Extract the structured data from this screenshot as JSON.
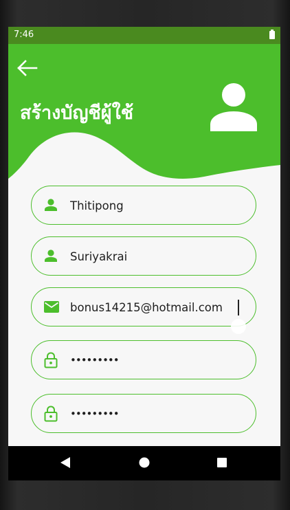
{
  "status_bar": {
    "time": "7:46"
  },
  "header": {
    "title": "สร้างบัญชีผู้ใช้",
    "accent_color": "#4cbe2c",
    "status_color": "#4a8a1f"
  },
  "form": {
    "first_name": {
      "value": "Thitipong",
      "icon": "person-icon"
    },
    "last_name": {
      "value": "Suriyakrai",
      "icon": "person-icon"
    },
    "email": {
      "value": "bonus14215@hotmail.com",
      "icon": "mail-icon"
    },
    "password": {
      "value": "•••••••••",
      "icon": "lock-icon"
    },
    "confirm_password": {
      "value": "•••••••••",
      "icon": "lock-icon"
    }
  },
  "nav": {
    "back": "back-triangle-icon",
    "home": "home-circle-icon",
    "recents": "recents-square-icon"
  }
}
